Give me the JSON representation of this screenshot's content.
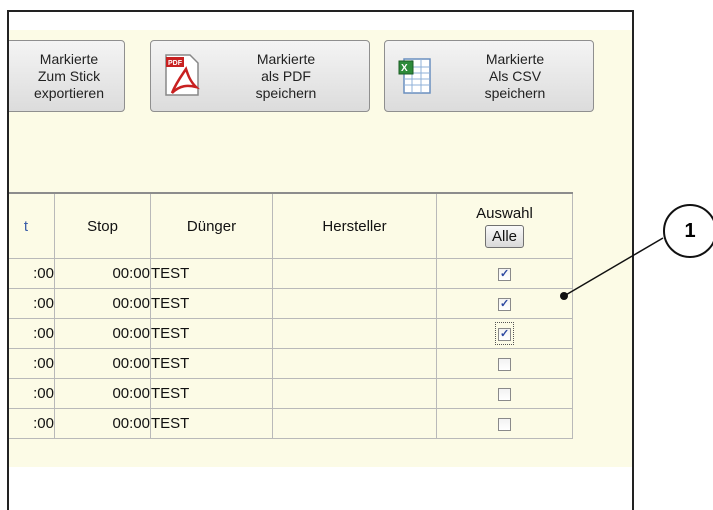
{
  "toolbar": {
    "export_stick_label": "Markierte\nZum Stick\nexportieren",
    "save_pdf_label": "Markierte\nals PDF\nspeichern",
    "save_csv_label": "Markierte\nAls CSV\nspeichern",
    "pdf_icon": "pdf-file-icon",
    "csv_icon": "spreadsheet-icon"
  },
  "table": {
    "headers": {
      "start": "t",
      "stop": "Stop",
      "duenger": "Dünger",
      "hersteller": "Hersteller",
      "auswahl": "Auswahl",
      "alle_button": "Alle"
    },
    "rows": [
      {
        "start": ":00",
        "stop": "00:00",
        "duenger": "TEST",
        "hersteller": "",
        "selected": true
      },
      {
        "start": ":00",
        "stop": "00:00",
        "duenger": "TEST",
        "hersteller": "",
        "selected": true
      },
      {
        "start": ":00",
        "stop": "00:00",
        "duenger": "TEST",
        "hersteller": "",
        "selected": true,
        "focused": true
      },
      {
        "start": ":00",
        "stop": "00:00",
        "duenger": "TEST",
        "hersteller": "",
        "selected": false
      },
      {
        "start": ":00",
        "stop": "00:00",
        "duenger": "TEST",
        "hersteller": "",
        "selected": false
      },
      {
        "start": ":00",
        "stop": "00:00",
        "duenger": "TEST",
        "hersteller": "",
        "selected": false
      }
    ]
  },
  "callout": {
    "number": "1"
  },
  "colors": {
    "panel_bg": "#fcfbe6",
    "check": "#2a46a0"
  }
}
